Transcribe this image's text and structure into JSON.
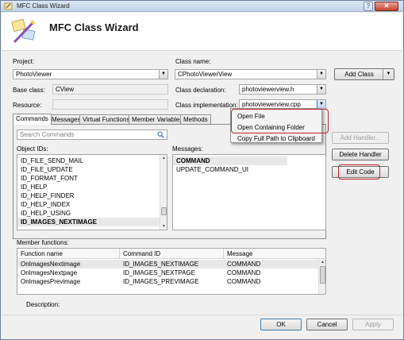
{
  "window": {
    "title": "MFC Class Wizard",
    "close_glyph": "✕",
    "help_glyph": "?"
  },
  "header": {
    "title": "MFC Class Wizard"
  },
  "project": {
    "label": "Project:",
    "value": "PhotoViewer"
  },
  "class_name": {
    "label": "Class name:",
    "value": "CPhotoViewerView"
  },
  "add_class_button": "Add Class",
  "base_class": {
    "label": "Base class:",
    "value": "CView"
  },
  "class_declaration": {
    "label": "Class declaration:",
    "value": "photoviewerview.h"
  },
  "resource": {
    "label": "Resource:",
    "value": ""
  },
  "class_implementation": {
    "label": "Class implementation:",
    "value": "photoviewerview.cpp"
  },
  "tabs": [
    "Commands",
    "Messages",
    "Virtual Functions",
    "Member Variables",
    "Methods"
  ],
  "search": {
    "placeholder": "Search Commands"
  },
  "object_ids": {
    "label": "Object IDs:",
    "items": [
      "ID_FILE_SEND_MAIL",
      "ID_FILE_UPDATE",
      "ID_FORMAT_FONT",
      "ID_HELP",
      "ID_HELP_FINDER",
      "ID_HELP_INDEX",
      "ID_HELP_USING",
      "ID_IMAGES_NEXTIMAGE"
    ]
  },
  "messages": {
    "label": "Messages:",
    "items": [
      "COMMAND",
      "UPDATE_COMMAND_UI"
    ]
  },
  "context_menu": [
    "Open File",
    "Open Containing Folder",
    "Copy Full Path to Clipboard"
  ],
  "buttons": {
    "add_handler": "Add Handler...",
    "delete_handler": "Delete Handler",
    "edit_code": "Edit Code",
    "ok": "OK",
    "cancel": "Cancel",
    "apply": "Apply"
  },
  "member_functions": {
    "label": "Member functions:",
    "columns": [
      "Function name",
      "Command ID",
      "Message"
    ],
    "rows": [
      [
        "OnImagesNextimage",
        "ID_IMAGES_NEXTIMAGE",
        "COMMAND"
      ],
      [
        "OnImagesNextpage",
        "ID_IMAGES_NEXTPAGE",
        "COMMAND"
      ],
      [
        "OnImagesPrevimage",
        "ID_IMAGES_PREVIMAGE",
        "COMMAND"
      ]
    ]
  },
  "description": {
    "label": "Description:"
  },
  "colors": {
    "highlight": "#c0202a",
    "title_gradient": "#c4d4ea"
  }
}
